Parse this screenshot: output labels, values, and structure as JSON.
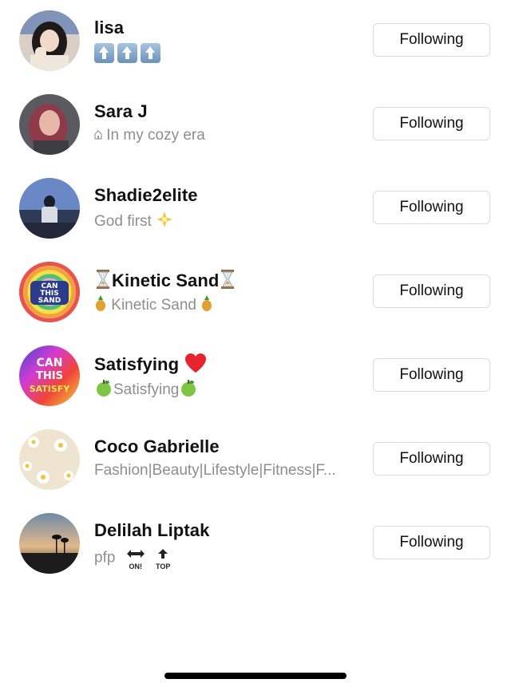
{
  "users": [
    {
      "name": "lisa",
      "bio": "",
      "button_label": "Following"
    },
    {
      "name": "Sara J",
      "bio": "In my cozy era",
      "bio_prefix_icon": "house-icon",
      "button_label": "Following"
    },
    {
      "name": "Shadie2elite",
      "bio": "God first",
      "bio_suffix_icon": "sparkle-star-icon",
      "button_label": "Following"
    },
    {
      "name": "Kinetic Sand",
      "name_icons": "hourglass-icon",
      "bio": "Kinetic Sand",
      "bio_icons": "pineapple-icon",
      "button_label": "Following"
    },
    {
      "name": "Satisfying",
      "name_suffix_icon": "red-heart-icon",
      "bio": "Satisfying",
      "bio_icons": "green-apple-icon",
      "button_label": "Following"
    },
    {
      "name": "Coco Gabrielle",
      "bio": "Fashion|Beauty|Lifestyle|Fitness|F...",
      "button_label": "Following"
    },
    {
      "name": "Delilah Liptak",
      "bio": "pfp",
      "bio_labels": [
        "ON!",
        "TOP"
      ],
      "button_label": "Following"
    }
  ],
  "avatars": {
    "kinetic_sand_text": [
      "CAN",
      "THIS",
      "SAND"
    ],
    "satisfying_text": [
      "CAN",
      "THIS",
      "SATISFY"
    ]
  },
  "colors": {
    "button_border": "#dbdbdb",
    "secondary_text": "#8e8e8e",
    "primary_text": "#111111"
  }
}
